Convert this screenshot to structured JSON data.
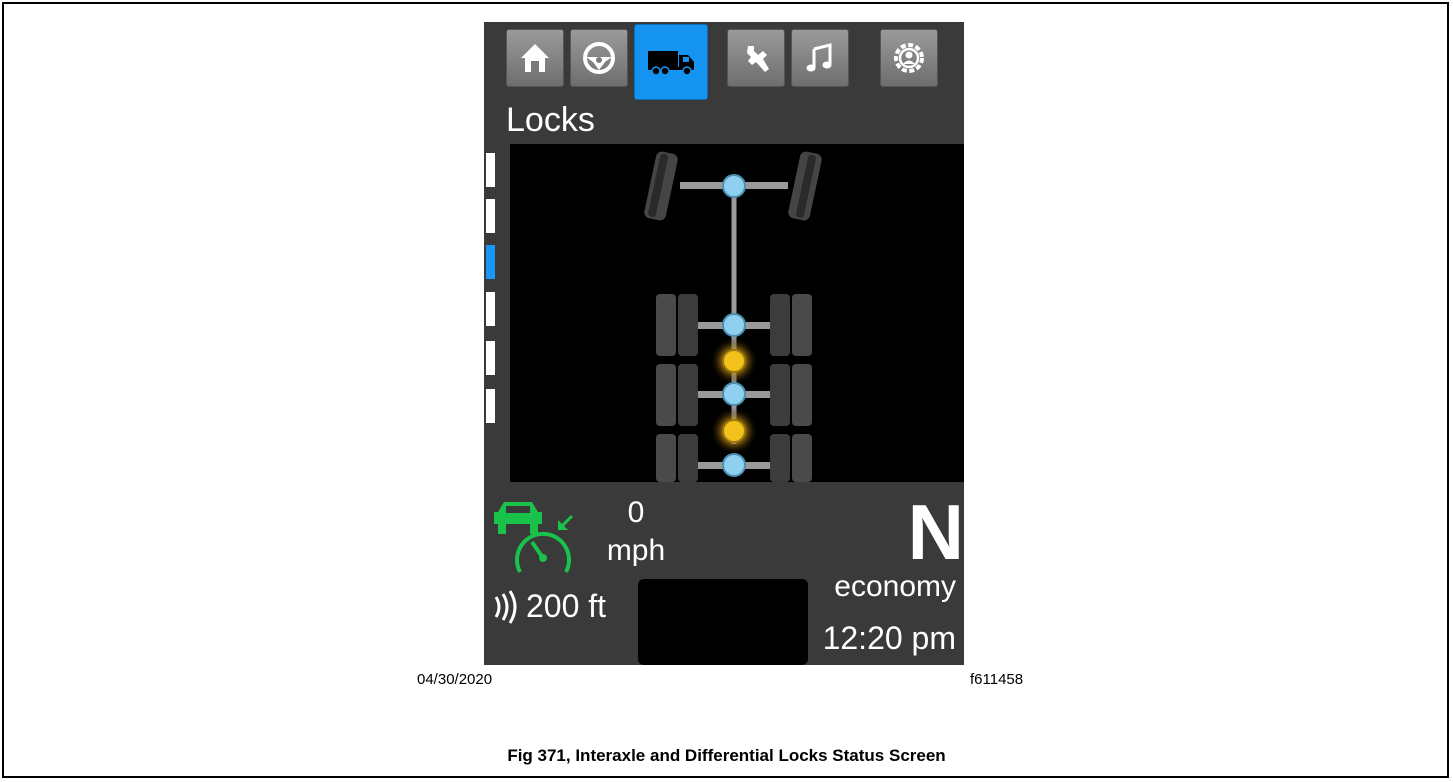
{
  "tabs": [
    {
      "icon": "home-icon",
      "active": false
    },
    {
      "icon": "steering-wheel-icon",
      "active": false
    },
    {
      "icon": "truck-icon",
      "active": true
    },
    {
      "icon": "wrench-icon",
      "active": false
    },
    {
      "icon": "music-note-icon",
      "active": false
    },
    {
      "icon": "settings-gear-icon",
      "active": false
    }
  ],
  "screen": {
    "title": "Locks",
    "speed_value": "0",
    "speed_unit": "mph",
    "gear": "N",
    "mode": "economy",
    "time": "12:20 pm",
    "distance": "200 ft"
  },
  "diagram": {
    "axles": [
      "steer",
      "drive-1",
      "drive-2",
      "drive-3"
    ],
    "engaged_locks": [
      "interaxle-1",
      "interaxle-2"
    ]
  },
  "figure": {
    "date": "04/30/2020",
    "code": "f611458",
    "caption": "Fig 371, Interaxle and Differential Locks Status Screen"
  },
  "colors": {
    "active_tab": "#1493f0",
    "cruise_icon": "#19c24a",
    "lock_engaged": "#f2c21a",
    "lock_disengaged": "#8fd0f0",
    "screen_bg": "#3a3a3a"
  }
}
